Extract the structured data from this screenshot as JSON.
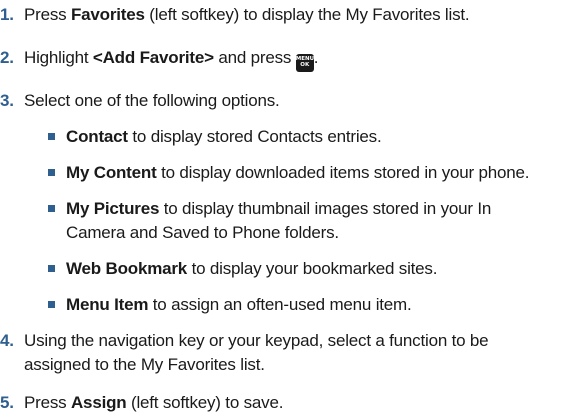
{
  "steps": [
    {
      "number": "1.",
      "before": "Press ",
      "bold": "Favorites",
      "after": " (left softkey) to display the My Favorites list."
    },
    {
      "number": "2.",
      "before": "Highlight ",
      "bold": "<Add Favorite>",
      "after": " and press ",
      "icon": {
        "name": "menu-ok-key-icon",
        "line1": "MENU",
        "line2": "OK"
      },
      "end": "."
    },
    {
      "number": "3.",
      "text": "Select one of the following options."
    },
    {
      "number": "4.",
      "line1": "Using the navigation key or your keypad, select a function to be",
      "line2": "assigned to the My Favorites list."
    },
    {
      "number": "5.",
      "before": "Press ",
      "bold": "Assign",
      "after": " (left softkey) to save."
    }
  ],
  "options": [
    {
      "bold": "Contact",
      "text": " to display stored Contacts entries."
    },
    {
      "bold": "My Content",
      "text": " to display downloaded items stored in your phone."
    },
    {
      "bold": "My Pictures",
      "text": " to display thumbnail images stored in your In",
      "line2": "Camera and Saved to Phone folders."
    },
    {
      "bold": "Web Bookmark",
      "text": " to display your bookmarked sites."
    },
    {
      "bold": "Menu Item",
      "text": " to assign an often-used menu item."
    }
  ],
  "colors": {
    "accent": "#2f5f8f",
    "text": "#1a1a1a"
  }
}
